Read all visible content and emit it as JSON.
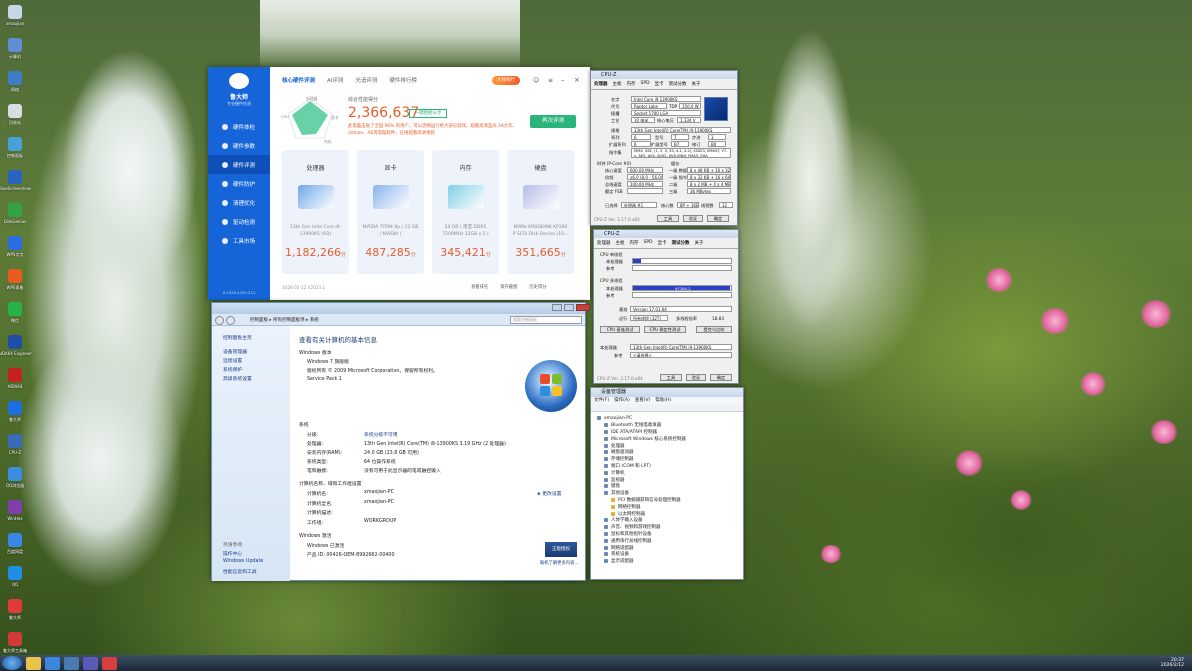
{
  "desktop": {
    "icons": [
      {
        "label": "xmaojian",
        "color": "#c9d6e6"
      },
      {
        "label": "计算机",
        "color": "#5f8fd0"
      },
      {
        "label": "网络",
        "color": "#3f7cc8"
      },
      {
        "label": "回收站",
        "color": "#d8dde4"
      },
      {
        "label": "控制面板",
        "color": "#4aa0d8"
      },
      {
        "label": "BlueScreenView",
        "color": "#2a62c0"
      },
      {
        "label": "DiskGenius",
        "color": "#32a148"
      },
      {
        "label": "WPS文字",
        "color": "#2b6de0"
      },
      {
        "label": "WPS表格",
        "color": "#e85c1f"
      },
      {
        "label": "微信",
        "color": "#27b34a"
      },
      {
        "label": "AIDA64 Engineer",
        "color": "#1e4ea8"
      },
      {
        "label": "AIDA64",
        "color": "#c42222"
      },
      {
        "label": "鲁大师",
        "color": "#1d6fe0"
      },
      {
        "label": "CPU-Z",
        "color": "#3a6bb8"
      },
      {
        "label": "QQ浏览器",
        "color": "#3d8ee0"
      },
      {
        "label": "WinHex",
        "color": "#7e3fa8"
      },
      {
        "label": "百度网盘",
        "color": "#3a87e8"
      },
      {
        "label": "QQ",
        "color": "#1e8ee8"
      },
      {
        "label": "鲁大师",
        "color": "#e03a3a"
      },
      {
        "label": "鲁大师工具箱",
        "color": "#d23a3a"
      }
    ]
  },
  "masterlu": {
    "logo_name": "鲁大师",
    "logo_sub": "专业硬件检测",
    "nav": [
      "硬件体检",
      "硬件参数",
      "硬件评测",
      "硬件防护",
      "清理优化",
      "驱动检测",
      "工具市场"
    ],
    "version": "6.1026.4325.212",
    "tabs": [
      "核心硬件评测",
      "AI评测",
      "光追评测",
      "硬件排行榜"
    ],
    "vip": "大师排行",
    "radar_labels": [
      "处理器",
      "显卡",
      "内存",
      "磁盘"
    ],
    "score_label": "综合性能得分",
    "score": "2,366,637",
    "share": "一键晒图分享",
    "desc": "此电脑击败了全国 96% 的用户，可以流畅运行绝大部分游戏，观看高清蓝光 3A大作、3dmax、AE等电脑软件，在线观看高清视频",
    "retest": "再次评测",
    "cards": [
      {
        "title": "处理器",
        "desc": "13th Gen Intel Core i9-13900KS (6Q)",
        "score": "1,182,266",
        "unit": "分"
      },
      {
        "title": "显卡",
        "desc": "NVIDIA TITAN Xp ( 12 GB / NVIDIA )",
        "score": "487,285",
        "unit": "分"
      },
      {
        "title": "内存",
        "desc": "24 GB ( 南亚 DDR5 7200MHz 12GB x 2 )",
        "score": "345,421",
        "unit": "分"
      },
      {
        "title": "硬盘",
        "desc": "NVMe KINGBANK KP260 P SCSI Disk Device (10...",
        "score": "351,665",
        "unit": "分"
      }
    ],
    "footer_date": "2026-02-12 V2023.1",
    "footer_links": [
      "查看排名",
      "保存截图",
      "历史得分"
    ]
  },
  "sysinfo": {
    "address": "控制面板 ▸ 所有控制面板项 ▸ 系统",
    "search_placeholder": "搜索控制面板",
    "left_home": "控制面板主页",
    "left_links": [
      "设备管理器",
      "远程设置",
      "系统保护",
      "高级系统设置"
    ],
    "see_also": "另请参阅",
    "see_links": [
      "操作中心",
      "Windows Update",
      "性能信息和工具"
    ],
    "heading": "查看有关计算机的基本信息",
    "edition_title": "Windows 版本",
    "edition": "Windows 7 旗舰版",
    "copyright": "版权所有 © 2009 Microsoft Corporation。保留所有权利。",
    "sp": "Service Pack 1",
    "system_title": "系统",
    "system_rows": [
      {
        "k": "分级:",
        "v": "系统分级不可用"
      },
      {
        "k": "处理器:",
        "v": "13th Gen Intel(R) Core(TM) i9-13900KS   3.19 GHz  (2 处理器)"
      },
      {
        "k": "安装内存(RAM):",
        "v": "24.0 GB (23.8 GB 可用)"
      },
      {
        "k": "系统类型:",
        "v": "64 位操作系统"
      },
      {
        "k": "笔和触摸:",
        "v": "没有可用于此显示器的笔或触控输入"
      }
    ],
    "computer_title": "计算机名称、域和工作组设置",
    "computer_rows": [
      {
        "k": "计算机名:",
        "v": "xmaojian-PC"
      },
      {
        "k": "计算机全名:",
        "v": "xmaojian-PC"
      },
      {
        "k": "计算机描述:",
        "v": ""
      },
      {
        "k": "工作组:",
        "v": "WORKGROUP"
      }
    ],
    "change_settings": "更改设置",
    "activation_title": "Windows 激活",
    "activated": "Windows 已激活",
    "product_id": "产品 ID: 00426-OEM-8992662-00400",
    "genuine_badge": "正版授权",
    "more_link": "联机了解更多内容..."
  },
  "cpuz1": {
    "title": "CPU-Z",
    "tabs": [
      "处理器",
      "主板",
      "内存",
      "SPD",
      "显卡",
      "测试分数",
      "关于"
    ],
    "fields": {
      "name": "Intel Core i9 13900KS",
      "code": "Raptor Lake",
      "tdp": "150.0 W",
      "socket": "Socket 1700 LGA",
      "tech": "10 纳米",
      "voltage": "1.334 V",
      "spec": "13th Gen Intel(R) Core(TM) i9-13900KS",
      "family": "6",
      "model": "7",
      "stepping": "1",
      "extfam": "6",
      "extmodel": "B7",
      "rev": "B0",
      "instr": "MMX, SSE, (1, 2, 3, 3S, 4.1, 4.2), SSSE3, EM64T, VT-x, AES, AVX, AVX2, AVX-VNNI, FMA3, SHA",
      "corespeed": "600.00 MHz",
      "mult": "x6.0 (8.0 - 56.0)",
      "bus": "100.00 MHz",
      "l1d": "8 x 48 KB + 16 x 32 KB",
      "l1i": "8 x 32 KB + 16 x 64 KB",
      "l2": "8 x 2 MB + 4 x 4 MB",
      "l3": "36 MBytes",
      "sel": "处理器 #1",
      "cores": "8P + 16E",
      "threads": "32"
    },
    "version": "CPU-Z   Ver. 2.17.0.x64",
    "buttons": [
      "工具",
      "验证",
      "确定"
    ]
  },
  "cpuz2": {
    "title": "CPU-Z",
    "tabs": [
      "处理器",
      "主板",
      "内存",
      "SPD",
      "显卡",
      "测试分数",
      "关于"
    ],
    "single_title": "CPU 单线程",
    "single_this": "本处理器",
    "single_this_val": "970.6",
    "single_this_frac": 0.08,
    "ref": "参考",
    "multi_title": "CPU 多线程",
    "multi_this_val": "97264.2",
    "multi_this_frac": 0.99,
    "bench_label": "基准",
    "bench_val": "Version 17.01.64",
    "threads_label": "运行",
    "threads_val": "所有线程 (32T)",
    "ratio_label": "多线程倍率",
    "ratio_val": "18.83",
    "btns": [
      "CPU 基准测试",
      "CPU 稳定性测试",
      "提交与比较"
    ],
    "this_proc": "13th Gen Intel(R) Core(TM) i9-13900KS",
    "ref_sel": "<请选择>",
    "version": "CPU-Z   Ver. 2.17.0.x64",
    "buttons": [
      "工具",
      "验证",
      "确定"
    ]
  },
  "devmgr": {
    "title": "设备管理器",
    "menu": [
      "文件(F)",
      "操作(A)",
      "查看(V)",
      "帮助(H)"
    ],
    "root": "xmaojian-PC",
    "items": [
      {
        "t": "Bluetooth 无线电收发器",
        "lvl": 1
      },
      {
        "t": "IDE ATA/ATAPI 控制器",
        "lvl": 1
      },
      {
        "t": "Microsoft Windows 核心系统控制器",
        "lvl": 1
      },
      {
        "t": "处理器",
        "lvl": 1
      },
      {
        "t": "磁盘驱动器",
        "lvl": 1
      },
      {
        "t": "存储控制器",
        "lvl": 1
      },
      {
        "t": "端口 (COM 和 LPT)",
        "lvl": 1
      },
      {
        "t": "计算机",
        "lvl": 1
      },
      {
        "t": "监视器",
        "lvl": 1
      },
      {
        "t": "键盘",
        "lvl": 1
      },
      {
        "t": "其他设备",
        "lvl": 1
      },
      {
        "t": "PCI 数据捕获和信号处理控制器",
        "lvl": 2
      },
      {
        "t": "网络控制器",
        "lvl": 2
      },
      {
        "t": "以太网控制器",
        "lvl": 2
      },
      {
        "t": "人体学输入设备",
        "lvl": 1
      },
      {
        "t": "声音、视频和游戏控制器",
        "lvl": 1
      },
      {
        "t": "鼠标和其他指针设备",
        "lvl": 1
      },
      {
        "t": "通用串行总线控制器",
        "lvl": 1
      },
      {
        "t": "网络适配器",
        "lvl": 1
      },
      {
        "t": "系统设备",
        "lvl": 1
      },
      {
        "t": "显示适配器",
        "lvl": 1
      }
    ]
  },
  "taskbar": {
    "time": "20:37",
    "date": "2026/2/12"
  }
}
